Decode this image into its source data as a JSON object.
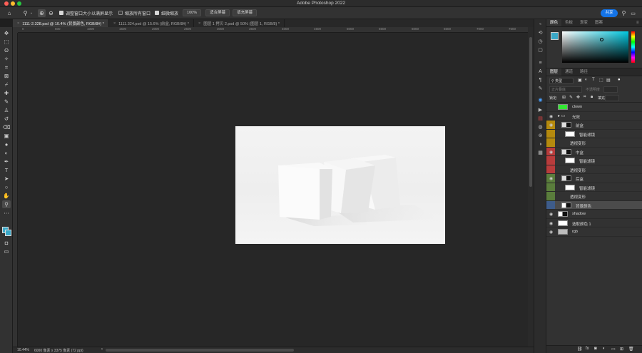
{
  "app": {
    "title": "Adobe Photoshop 2022"
  },
  "window_controls": {
    "close_color": "#ff5f57",
    "minimize_color": "#febc2e",
    "zoom_color": "#28c840"
  },
  "options_bar": {
    "home_icon": "home-icon",
    "zoom_tool_icon": "zoom-tool-icon",
    "zoom_in_icon": "zoom-in-icon",
    "zoom_out_icon": "zoom-out-icon",
    "resize_windows_label": "调整窗口大小以满屏显示",
    "resize_windows_checked": true,
    "zoom_all_windows_label": "缩放所有窗口",
    "zoom_all_windows_checked": false,
    "scrubby_zoom_label": "细微缩放",
    "scrubby_zoom_checked": true,
    "zoom_percent": "100%",
    "fit_screen_label": "适合屏幕",
    "fill_screen_label": "填充屏幕",
    "share_label": "共享",
    "accent_color": "#1473e6"
  },
  "tabs": [
    {
      "label": "1111-2.328.psd @ 10.4% (背景颜色, RGB/8#) *",
      "active": true
    },
    {
      "label": "1111.324.psd @ 15.6% (前盒, RGB/8#) *",
      "active": false
    },
    {
      "label": "图层 1 拷贝 2.psd @ 50% (图层 1, RGB/8) *",
      "active": false
    }
  ],
  "ruler_ticks": [
    "0",
    "500",
    "1000",
    "1500",
    "2000",
    "2500",
    "3000",
    "3500",
    "4000",
    "4500",
    "5000",
    "5500",
    "6000",
    "6500",
    "7000",
    "7500"
  ],
  "status": {
    "zoom": "10.44%",
    "doc_size": "6000 像素 x 3375 像素 (72 ppi)"
  },
  "color_panel": {
    "tabs": [
      "颜色",
      "色板",
      "渐变",
      "图案"
    ],
    "foreground_color": "#3aa8c8",
    "background_color": "#ffffff",
    "hue_color": "#00c8e0"
  },
  "layers_panel": {
    "tabs": [
      "图层",
      "通道",
      "路径"
    ],
    "filter_label": "类型",
    "blend_mode": "正片叠底",
    "opacity_label": "不透明度",
    "lock_label": "锁定:",
    "fill_label": "填充",
    "layers": [
      {
        "name": "clown",
        "indent": 0,
        "visible": false,
        "tag_color": "",
        "thumb": "#34e834"
      },
      {
        "name": "光效",
        "indent": 0,
        "visible": true,
        "tag_color": "",
        "thumb": "folder"
      },
      {
        "name": "前盒",
        "indent": 1,
        "visible": true,
        "tag_color": "#b58a0e",
        "thumb": "smart"
      },
      {
        "name": "智能滤镜",
        "indent": 2,
        "visible": false,
        "tag_color": "#b58a0e",
        "thumb": "white"
      },
      {
        "name": "透视变形",
        "indent": 3,
        "visible": false,
        "tag_color": "#b58a0e",
        "thumb": ""
      },
      {
        "name": "中盒",
        "indent": 1,
        "visible": true,
        "tag_color": "#b83c3c",
        "thumb": "smart"
      },
      {
        "name": "智能滤镜",
        "indent": 2,
        "visible": false,
        "tag_color": "#b83c3c",
        "thumb": "white"
      },
      {
        "name": "透视变形",
        "indent": 3,
        "visible": false,
        "tag_color": "#b83c3c",
        "thumb": ""
      },
      {
        "name": "后盒",
        "indent": 1,
        "visible": true,
        "tag_color": "#5a7d3c",
        "thumb": "smart"
      },
      {
        "name": "智能滤镜",
        "indent": 2,
        "visible": false,
        "tag_color": "#5a7d3c",
        "thumb": "white"
      },
      {
        "name": "透视变形",
        "indent": 3,
        "visible": false,
        "tag_color": "#5a7d3c",
        "thumb": ""
      },
      {
        "name": "背景颜色",
        "indent": 1,
        "visible": false,
        "tag_color": "#3e5c8a",
        "thumb": "mask",
        "selected": true
      },
      {
        "name": "shadow",
        "indent": 0,
        "visible": true,
        "tag_color": "",
        "thumb": "mask"
      },
      {
        "name": "选取颜色 1",
        "indent": 0,
        "visible": true,
        "tag_color": "",
        "thumb": "adj"
      },
      {
        "name": "rgb",
        "indent": 0,
        "visible": true,
        "tag_color": "",
        "thumb": "gray"
      }
    ],
    "footer_icons": [
      "link-icon",
      "fx-icon",
      "mask-icon",
      "adjustment-icon",
      "group-icon",
      "new-layer-icon",
      "trash-icon"
    ]
  }
}
